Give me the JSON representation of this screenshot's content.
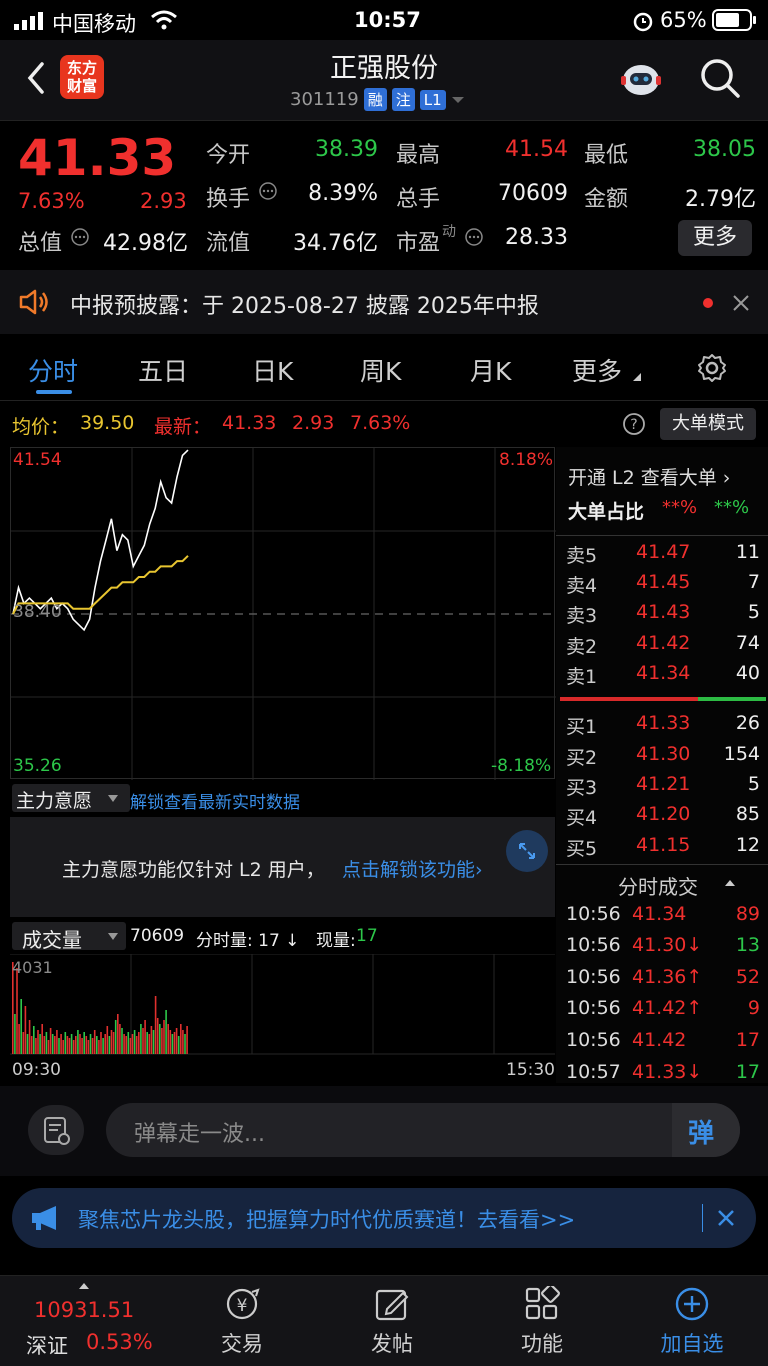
{
  "status_bar": {
    "carrier": "中国移动",
    "time": "10:57",
    "battery": "65%"
  },
  "header": {
    "logo_text": "东方财富",
    "title": "正强股份",
    "code": "301119",
    "tags": [
      "融",
      "注",
      "L1"
    ]
  },
  "quote": {
    "price": "41.33",
    "change_pct": "7.63%",
    "change": "2.93",
    "fields": [
      {
        "label": "今开",
        "value": "38.39",
        "color": "green"
      },
      {
        "label": "最高",
        "value": "41.54",
        "color": "red"
      },
      {
        "label": "最低",
        "value": "38.05",
        "color": "green"
      },
      {
        "label": "换手",
        "value": "8.39%",
        "color": "white"
      },
      {
        "label": "总手",
        "value": "70609",
        "color": "white"
      },
      {
        "label": "金额",
        "value": "2.79亿",
        "color": "white"
      },
      {
        "label": "总值",
        "value": "42.98亿",
        "color": "white"
      },
      {
        "label": "流值",
        "value": "34.76亿",
        "color": "white"
      },
      {
        "label": "市盈",
        "value": "28.33",
        "color": "white"
      }
    ],
    "pe_superscript": "动",
    "more_label": "更多"
  },
  "notice": {
    "text": "中报预披露：于 2025-08-27 披露 2025年中报"
  },
  "tabs": [
    "分时",
    "五日",
    "日K",
    "周K",
    "月K",
    "更多"
  ],
  "info_line": {
    "avg_label": "均价：",
    "avg_value": "39.50",
    "latest_label": "最新：",
    "latest_value": "41.33",
    "latest_change": "2.93",
    "latest_pct": "7.63%",
    "mode_label": "大单模式"
  },
  "chart_labels": {
    "high": "41.54",
    "high_pct": "8.18%",
    "mid": "38.40",
    "low": "35.26",
    "low_pct": "-8.18%"
  },
  "chart_data": {
    "type": "line",
    "series": [
      {
        "values": [
          38.4,
          38.9,
          38.6,
          38.7,
          38.6,
          38.5,
          38.6,
          38.7,
          38.5,
          38.6,
          38.5,
          38.3,
          38.2,
          38.1,
          38.3,
          38.9,
          39.4,
          39.8,
          40.2,
          39.6,
          39.9,
          39.8,
          39.3,
          39.5,
          39.7,
          40.1,
          40.4,
          40.9,
          40.6,
          40.5,
          41.0,
          41.4,
          41.5
        ]
      },
      {
        "values": [
          38.4,
          38.6,
          38.6,
          38.6,
          38.6,
          38.6,
          38.6,
          38.6,
          38.6,
          38.6,
          38.6,
          38.5,
          38.5,
          38.5,
          38.5,
          38.6,
          38.7,
          38.8,
          38.9,
          38.9,
          39.0,
          39.0,
          39.0,
          39.1,
          39.1,
          39.2,
          39.2,
          39.3,
          39.3,
          39.3,
          39.4,
          39.4,
          39.5
        ]
      }
    ],
    "ylim": [
      35.26,
      41.54
    ]
  },
  "orderbook": {
    "promo": "开通 L2 查看大单 ›",
    "ratio_label": "大单占比",
    "ratio_red": "**%",
    "ratio_green": "**%",
    "asks": [
      {
        "label": "卖5",
        "price": "41.47",
        "vol": "11"
      },
      {
        "label": "卖4",
        "price": "41.45",
        "vol": "7"
      },
      {
        "label": "卖3",
        "price": "41.43",
        "vol": "5"
      },
      {
        "label": "卖2",
        "price": "41.42",
        "vol": "74"
      },
      {
        "label": "卖1",
        "price": "41.34",
        "vol": "40"
      }
    ],
    "bids": [
      {
        "label": "买1",
        "price": "41.33",
        "vol": "26"
      },
      {
        "label": "买2",
        "price": "41.30",
        "vol": "154"
      },
      {
        "label": "买3",
        "price": "41.21",
        "vol": "5"
      },
      {
        "label": "买4",
        "price": "41.20",
        "vol": "85"
      },
      {
        "label": "买5",
        "price": "41.15",
        "vol": "12"
      }
    ],
    "ticks_title": "分时成交",
    "ticks": [
      {
        "time": "10:56",
        "price": "41.34",
        "vol": "89",
        "vc": "red"
      },
      {
        "time": "10:56",
        "price": "41.30↓",
        "vol": "13",
        "vc": "green"
      },
      {
        "time": "10:56",
        "price": "41.36↑",
        "vol": "52",
        "vc": "red"
      },
      {
        "time": "10:56",
        "price": "41.42↑",
        "vol": "9",
        "vc": "red"
      },
      {
        "time": "10:56",
        "price": "41.42",
        "vol": "17",
        "vc": "red"
      },
      {
        "time": "10:57",
        "price": "41.33↓",
        "vol": "17",
        "vc": "green"
      }
    ]
  },
  "intention": {
    "dropdown": "主力意愿",
    "unlock_link": "解锁查看最新实时数据",
    "message": "主力意愿功能仅针对 L2 用户，",
    "message_link": "点击解锁该功能›"
  },
  "volume": {
    "dropdown": "成交量",
    "total": "70609",
    "minute_label": "分时量: 17 ↓",
    "now_label": "现量:",
    "now_value": "17",
    "max_label": "4031",
    "time_start": "09:30",
    "time_end": "15:30"
  },
  "comment": {
    "placeholder": "弹幕走一波...",
    "button": "弹"
  },
  "banner": {
    "text": "聚焦芯片龙头股，把握算力时代优质赛道！去看看>>"
  },
  "bottom_nav": {
    "index_value": "10931.51",
    "index_name": "深证",
    "index_pct": "0.53%",
    "items": [
      "交易",
      "发帖",
      "功能",
      "加自选"
    ]
  }
}
